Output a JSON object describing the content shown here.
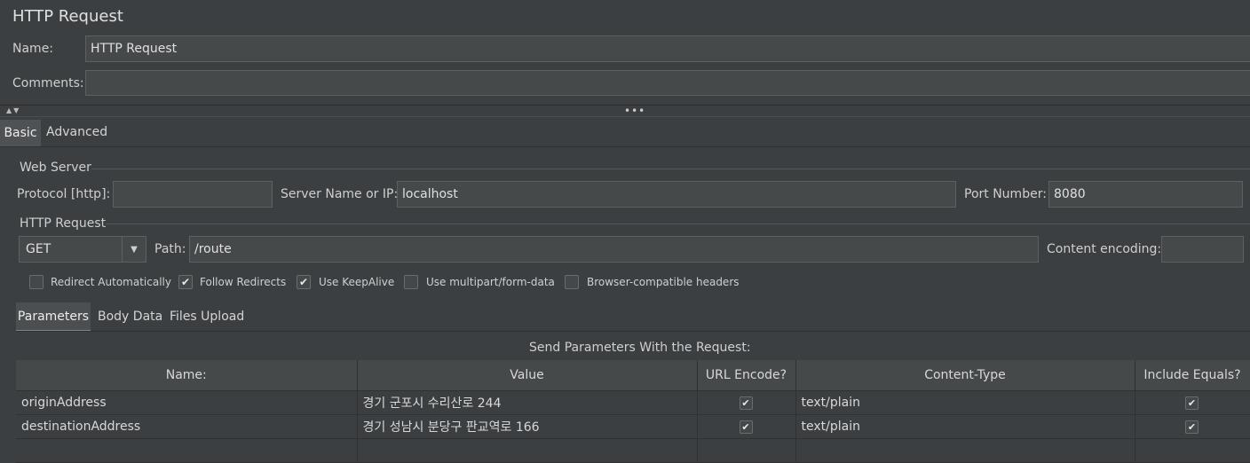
{
  "title": "HTTP Request",
  "name_label": "Name:",
  "name_value": "HTTP Request",
  "comments_label": "Comments:",
  "comments_value": "",
  "tabs": [
    "Basic",
    "Advanced"
  ],
  "web_server": {
    "section_title": "Web Server",
    "protocol_label": "Protocol [http]:",
    "protocol_value": "",
    "server_label": "Server Name or IP:",
    "server_value": "localhost",
    "port_label": "Port Number:",
    "port_value": "8080"
  },
  "http_request": {
    "section_title": "HTTP Request",
    "method": "GET",
    "path_label": "Path:",
    "path_value": "/route",
    "encoding_label": "Content encoding:",
    "encoding_value": ""
  },
  "options": [
    {
      "label": "Redirect Automatically",
      "checked": false
    },
    {
      "label": "Follow Redirects",
      "checked": true
    },
    {
      "label": "Use KeepAlive",
      "checked": true
    },
    {
      "label": "Use multipart/form-data",
      "checked": false
    },
    {
      "label": "Browser-compatible headers",
      "checked": false
    }
  ],
  "subtabs": [
    "Parameters",
    "Body Data",
    "Files Upload"
  ],
  "params_caption": "Send Parameters With the Request:",
  "columns": [
    "Name:",
    "Value",
    "URL Encode?",
    "Content-Type",
    "Include Equals?"
  ],
  "rows": [
    {
      "name": "originAddress",
      "value": "경기 군포시 수리산로 244",
      "url_encode": true,
      "content_type": "text/plain",
      "include_equals": true
    },
    {
      "name": "destinationAddress",
      "value": "경기 성남시 분당구 판교역로 166",
      "url_encode": true,
      "content_type": "text/plain",
      "include_equals": true
    }
  ]
}
